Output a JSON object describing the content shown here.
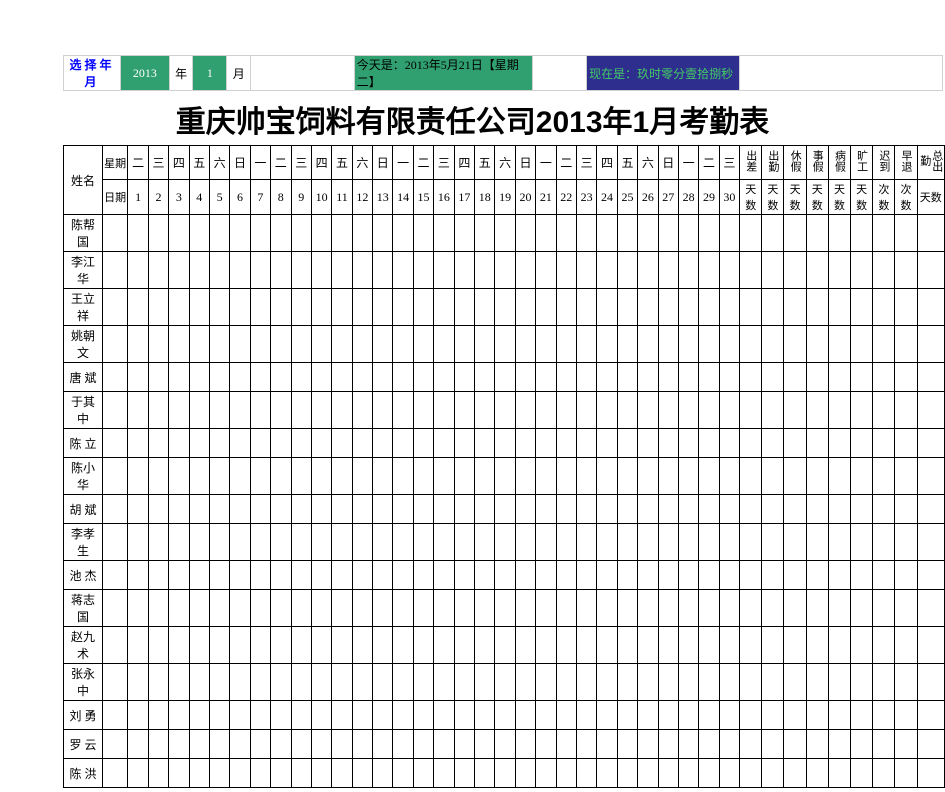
{
  "ctrl": {
    "select_label": "选择年月",
    "year_value": "2013",
    "year_word": "年",
    "month_value": "1",
    "month_word": "月",
    "today_text": "今天是：2013年5月21日【星期二】",
    "now_text": "现在是：玖时零分壹拾捌秒"
  },
  "title": "重庆帅宝饲料有限责任公司2013年1月考勤表",
  "headers": {
    "name": "姓名",
    "weekday_label": "星期",
    "date_label": "日期",
    "weekdays": [
      "二",
      "三",
      "四",
      "五",
      "六",
      "日",
      "一",
      "二",
      "三",
      "四",
      "五",
      "六",
      "日",
      "一",
      "二",
      "三",
      "四",
      "五",
      "六",
      "日",
      "一",
      "二",
      "三",
      "四",
      "五",
      "六",
      "日",
      "一",
      "二",
      "三"
    ],
    "dates": [
      "1",
      "2",
      "3",
      "4",
      "5",
      "6",
      "7",
      "8",
      "9",
      "10",
      "11",
      "12",
      "13",
      "14",
      "15",
      "16",
      "17",
      "18",
      "19",
      "20",
      "21",
      "22",
      "23",
      "24",
      "25",
      "26",
      "27",
      "28",
      "29",
      "30"
    ],
    "summaries": [
      "出差",
      "出勤",
      "休假",
      "事假",
      "病假",
      "旷工",
      "迟到",
      "早退",
      "总出勤"
    ],
    "summaries_units": [
      "天数",
      "天数",
      "天数",
      "天数",
      "天数",
      "天数",
      "次数",
      "次数",
      "天数"
    ]
  },
  "names": [
    "陈帮国",
    "李江华",
    "王立祥",
    "姚朝文",
    "唐  斌",
    "于其中",
    "陈  立",
    "陈小华",
    "胡  斌",
    "李孝生",
    "池  杰",
    "蒋志国",
    "赵九术",
    "张永中",
    "刘  勇",
    "罗  云",
    "陈  洪"
  ]
}
